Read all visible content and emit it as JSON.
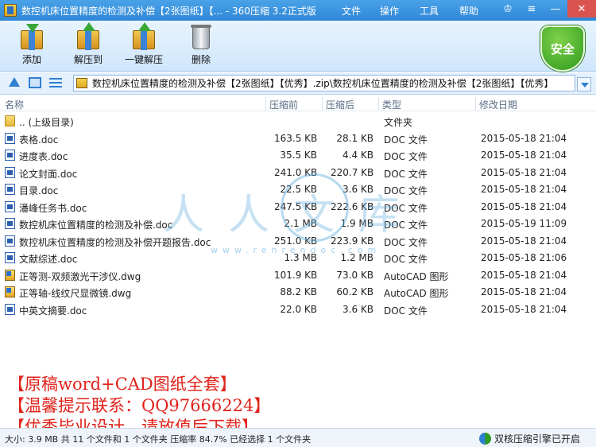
{
  "window": {
    "title": "数控机床位置精度的检测及补偿【2张图纸】【... - 360压缩 3.2正式版",
    "menu": [
      "文件",
      "操作",
      "工具",
      "帮助"
    ]
  },
  "toolbar": {
    "items": [
      {
        "label": "添加",
        "icon": "add-archive-icon"
      },
      {
        "label": "解压到",
        "icon": "extract-to-icon"
      },
      {
        "label": "一键解压",
        "icon": "one-click-extract-icon"
      },
      {
        "label": "删除",
        "icon": "delete-bin-icon"
      }
    ],
    "security_badge": "安全"
  },
  "address": {
    "path": "数控机床位置精度的检测及补偿【2张图纸】【优秀】.zip\\数控机床位置精度的检测及补偿【2张图纸】【优秀】"
  },
  "columns": {
    "name": "名称",
    "size": "压缩前",
    "packed": "压缩后",
    "type": "类型",
    "date": "修改日期"
  },
  "files": [
    {
      "name": ".. (上级目录)",
      "size": "",
      "packed": "",
      "type": "文件夹",
      "date": "",
      "icon": "folder"
    },
    {
      "name": "表格.doc",
      "size": "163.5 KB",
      "packed": "28.1 KB",
      "type": "DOC 文件",
      "date": "2015-05-18 21:04",
      "icon": "doc"
    },
    {
      "name": "进度表.doc",
      "size": "35.5 KB",
      "packed": "4.4 KB",
      "type": "DOC 文件",
      "date": "2015-05-18 21:04",
      "icon": "doc"
    },
    {
      "name": "论文封面.doc",
      "size": "241.0 KB",
      "packed": "220.7 KB",
      "type": "DOC 文件",
      "date": "2015-05-18 21:04",
      "icon": "doc"
    },
    {
      "name": "目录.doc",
      "size": "22.5 KB",
      "packed": "3.6 KB",
      "type": "DOC 文件",
      "date": "2015-05-18 21:04",
      "icon": "doc"
    },
    {
      "name": "潘峰任务书.doc",
      "size": "247.5 KB",
      "packed": "222.6 KB",
      "type": "DOC 文件",
      "date": "2015-05-18 21:04",
      "icon": "doc"
    },
    {
      "name": "数控机床位置精度的检测及补偿.doc",
      "size": "2.1 MB",
      "packed": "1.9 MB",
      "type": "DOC 文件",
      "date": "2015-05-19 11:09",
      "icon": "doc"
    },
    {
      "name": "数控机床位置精度的检测及补偿开题报告.doc",
      "size": "251.0 KB",
      "packed": "223.9 KB",
      "type": "DOC 文件",
      "date": "2015-05-18 21:04",
      "icon": "doc"
    },
    {
      "name": "文献综述.doc",
      "size": "1.3 MB",
      "packed": "1.2 MB",
      "type": "DOC 文件",
      "date": "2015-05-18 21:06",
      "icon": "doc"
    },
    {
      "name": "正等测-双频激光干涉仪.dwg",
      "size": "101.9 KB",
      "packed": "73.0 KB",
      "type": "AutoCAD 图形",
      "date": "2015-05-18 21:04",
      "icon": "dwg"
    },
    {
      "name": "正等轴-线纹尺显微镜.dwg",
      "size": "88.2 KB",
      "packed": "60.2 KB",
      "type": "AutoCAD 图形",
      "date": "2015-05-18 21:04",
      "icon": "dwg"
    },
    {
      "name": "中英文摘要.doc",
      "size": "22.0 KB",
      "packed": "3.6 KB",
      "type": "DOC 文件",
      "date": "2015-05-18 21:04",
      "icon": "doc"
    }
  ],
  "watermark": {
    "text": "人人文库",
    "url": "www.renrendoc.com"
  },
  "promo": [
    "【原稿word+CAD图纸全套】",
    "【温馨提示联系：QQ97666224】",
    "【优秀毕业设计，请放值后下载】"
  ],
  "status": {
    "text": "大小: 3.9 MB 共 11 个文件和 1 个文件夹 压缩率 84.7% 已经选择 1 个文件夹",
    "engine": "双核压缩引擎已开启"
  }
}
